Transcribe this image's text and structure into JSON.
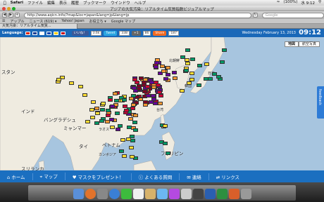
{
  "menubar": {
    "app": "Safari",
    "items": [
      "ファイル",
      "編集",
      "表示",
      "履歴",
      "ブックマーク",
      "ウインドウ",
      "ヘルプ"
    ],
    "battery": "(100%)",
    "clock": "水 9:12"
  },
  "window": {
    "title": "アジアの大気汚染：リアルタイム気質指数ビジュアルマップ"
  },
  "toolbar": {
    "url": "http://www.aqicn.info/?map&loc=japan&lang=jp&lang=jp",
    "search_placeholder": "Google"
  },
  "bookmarks": [
    "アップル",
    "ニュース (619) ▾",
    "Yahoo! Japan",
    "お役立ち ▾",
    "Google マップ"
  ],
  "tab": {
    "label": "大気汚染：リアルタイム気質..."
  },
  "header": {
    "language_label": "Language:",
    "like_label": "いいね！",
    "like_count": "3.6k",
    "tweet_label": "Tweet",
    "tweet_count": "338",
    "plus_label": "+1",
    "plus_count": "86",
    "share_label": "Share",
    "share_count": "187",
    "date": "Wednesday February 13, 2013",
    "time": "09:12"
  },
  "map": {
    "type_map": "地図",
    "type_satellite": "航空写真",
    "feedback": "feedback",
    "labels": [
      "スタン",
      "インド",
      "バングラデシュ",
      "ミャンマー",
      "タイ",
      "ベトナム",
      "フィリピン",
      "スリランカ",
      "ラオス",
      "カンボジア",
      "北朝鮮",
      "韓国",
      "日本",
      "台湾"
    ]
  },
  "nav": {
    "items": [
      "⌂ ホーム",
      "⌖ マップ",
      "♥ マスクをプレゼント！",
      "ⓘ よくある質問",
      "✉ 連絡",
      "⇄ リンクス"
    ]
  },
  "colors": {
    "header_blue": "#1a68b8",
    "nav_blue": "#1b6fc0",
    "aqi_good": "#009966",
    "aqi_moderate": "#ffde33",
    "aqi_unhealthy_sensitive": "#ff9933",
    "aqi_unhealthy": "#cc0033",
    "aqi_very_unhealthy": "#660099",
    "aqi_hazardous": "#7e0023"
  }
}
